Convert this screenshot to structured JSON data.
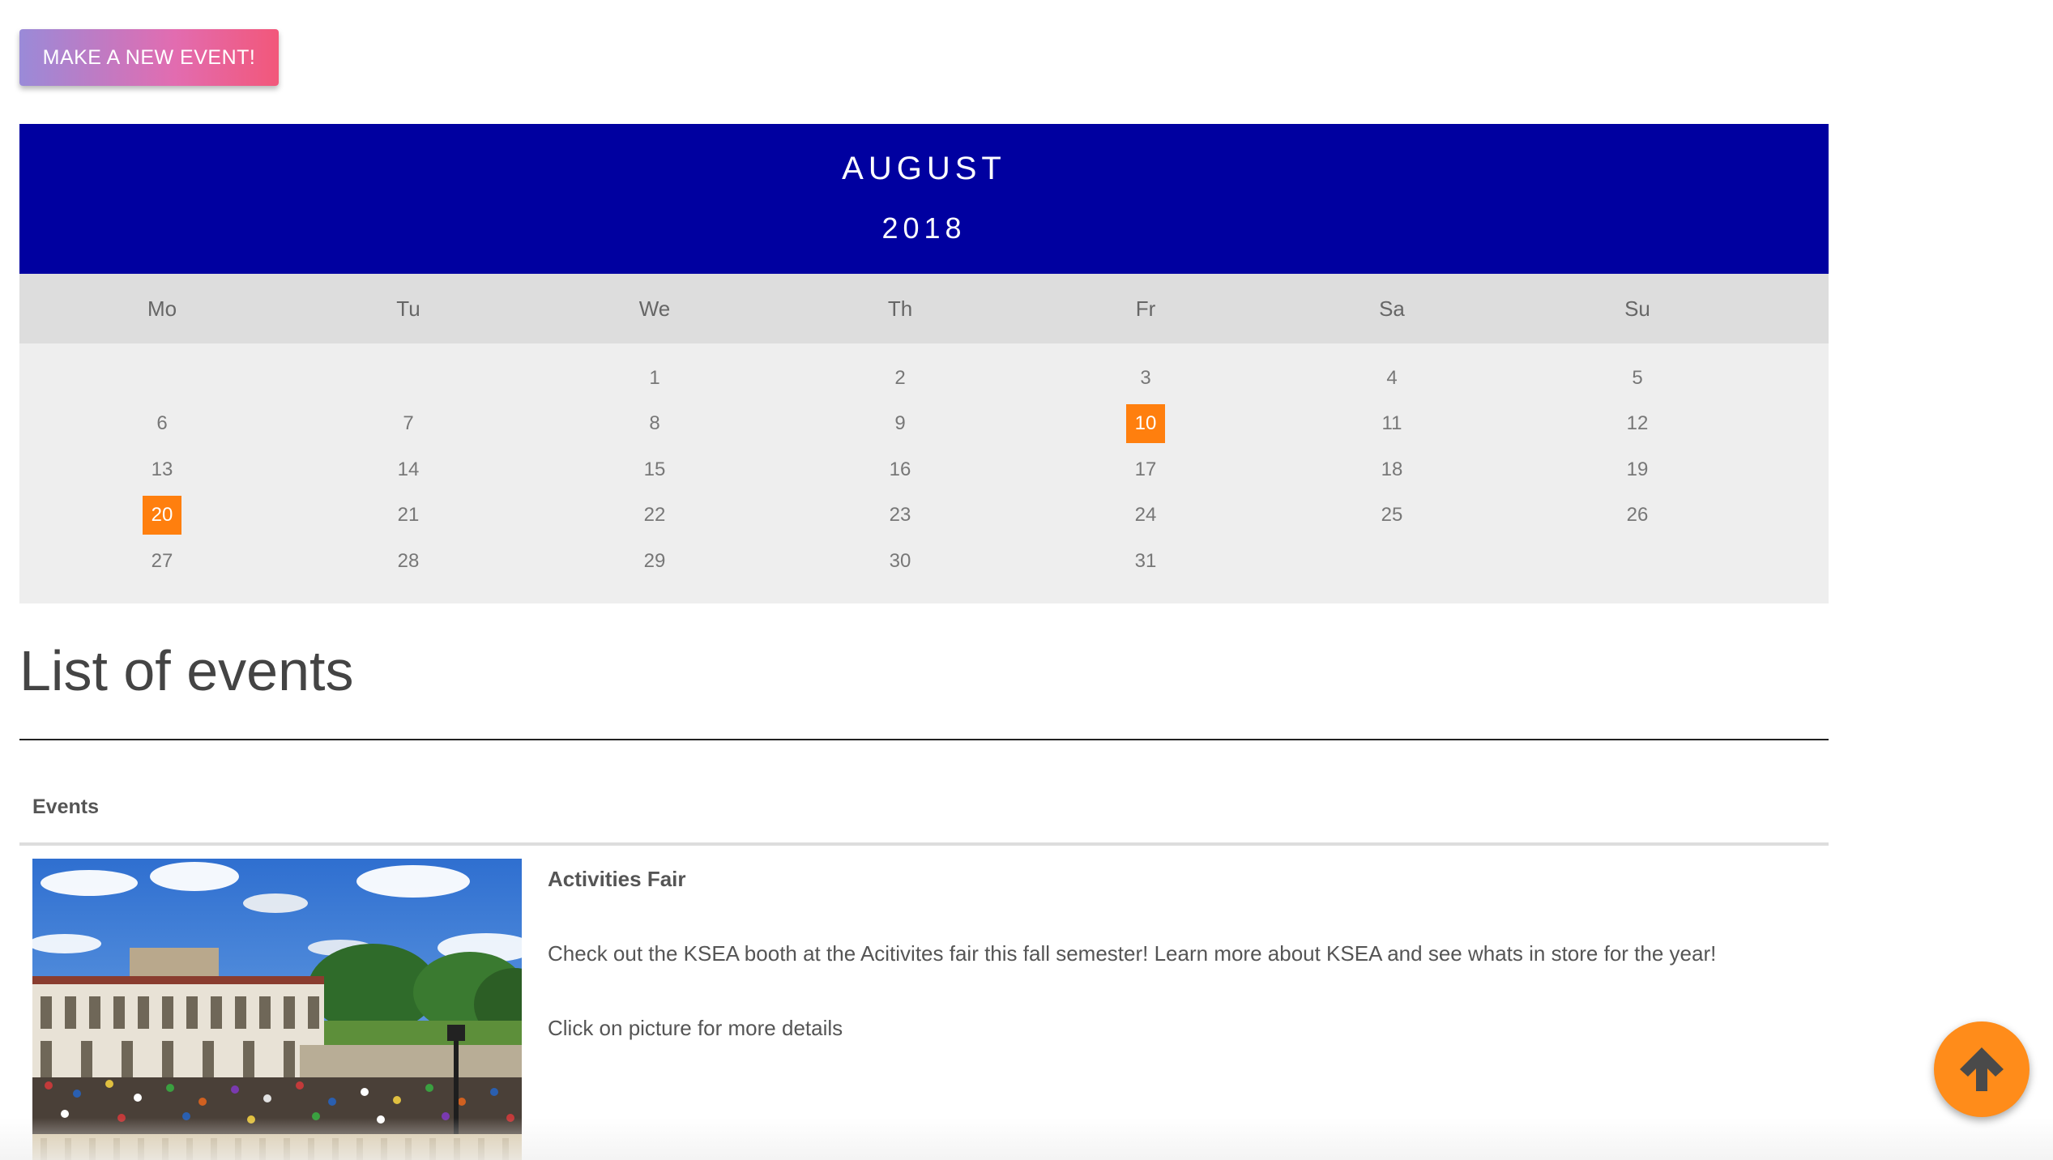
{
  "toolbar": {
    "new_event_label": "MAKE A NEW EVENT!"
  },
  "calendar": {
    "month": "AUGUST",
    "year": "2018",
    "weekdays": [
      "Mo",
      "Tu",
      "We",
      "Th",
      "Fr",
      "Sa",
      "Su"
    ],
    "weeks": [
      [
        "",
        "",
        "1",
        "2",
        "3",
        "4",
        "5"
      ],
      [
        "6",
        "7",
        "8",
        "9",
        "10",
        "11",
        "12"
      ],
      [
        "13",
        "14",
        "15",
        "16",
        "17",
        "18",
        "19"
      ],
      [
        "20",
        "21",
        "22",
        "23",
        "24",
        "25",
        "26"
      ],
      [
        "27",
        "28",
        "29",
        "30",
        "31",
        "",
        ""
      ]
    ],
    "event_days": [
      "10",
      "20"
    ],
    "header_color": "#0000a0",
    "highlight_color": "#ff7f0e"
  },
  "events_section": {
    "title": "List of events",
    "table_header": "Events"
  },
  "events": [
    {
      "title": "Activities Fair",
      "description": "Check out the KSEA booth at the Acitivites fair this fall semester! Learn more about KSEA and see whats in store for the year!",
      "more": "Click on picture for more details"
    }
  ],
  "scroll_top": {
    "icon": "arrow-up-icon",
    "color": "#ff8c1a"
  }
}
